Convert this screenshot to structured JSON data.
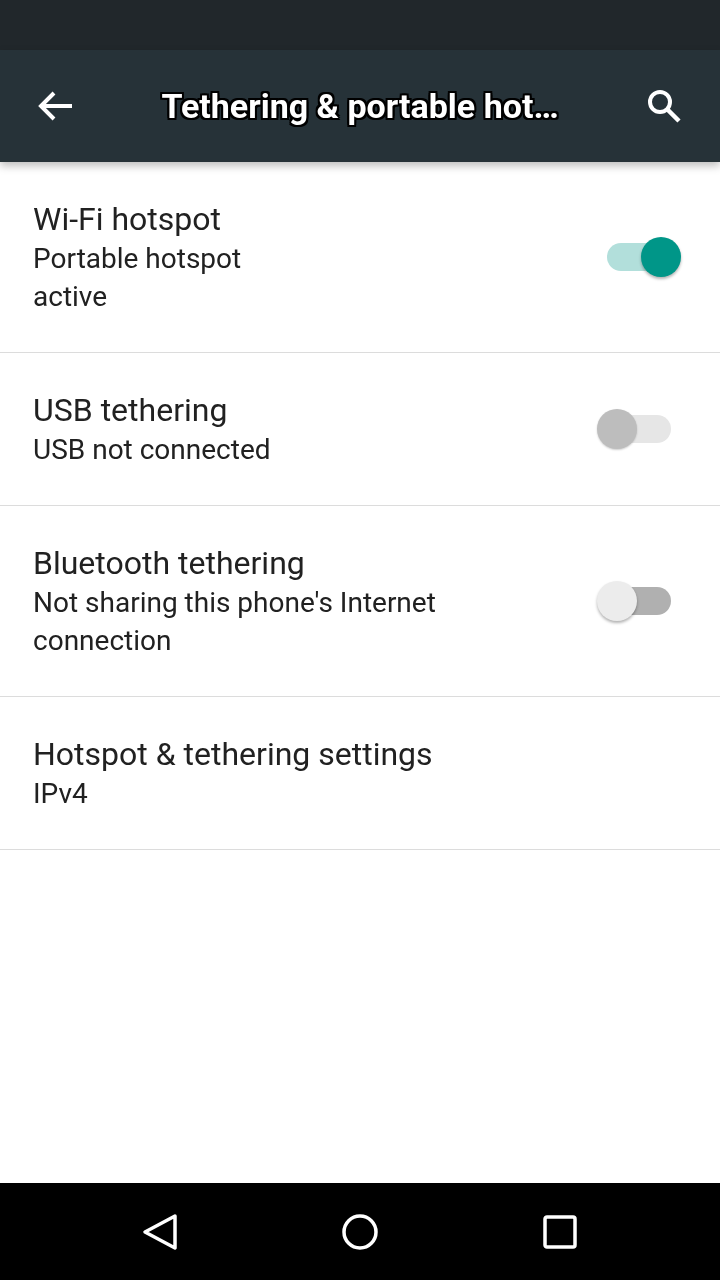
{
  "app_bar": {
    "title": "Tethering & portable hot…"
  },
  "settings": [
    {
      "kind": "switch",
      "title": "Wi-Fi hotspot",
      "summary": "Portable hotspot\nactive",
      "checked": true,
      "disabled": false
    },
    {
      "kind": "switch",
      "title": "USB tethering",
      "summary": "USB not connected",
      "checked": false,
      "disabled": true
    },
    {
      "kind": "switch",
      "title": "Bluetooth tethering",
      "summary": "Not sharing this phone's Internet connection",
      "checked": false,
      "disabled": false
    },
    {
      "kind": "link",
      "title": "Hotspot & tethering settings",
      "summary": "IPv4"
    }
  ]
}
